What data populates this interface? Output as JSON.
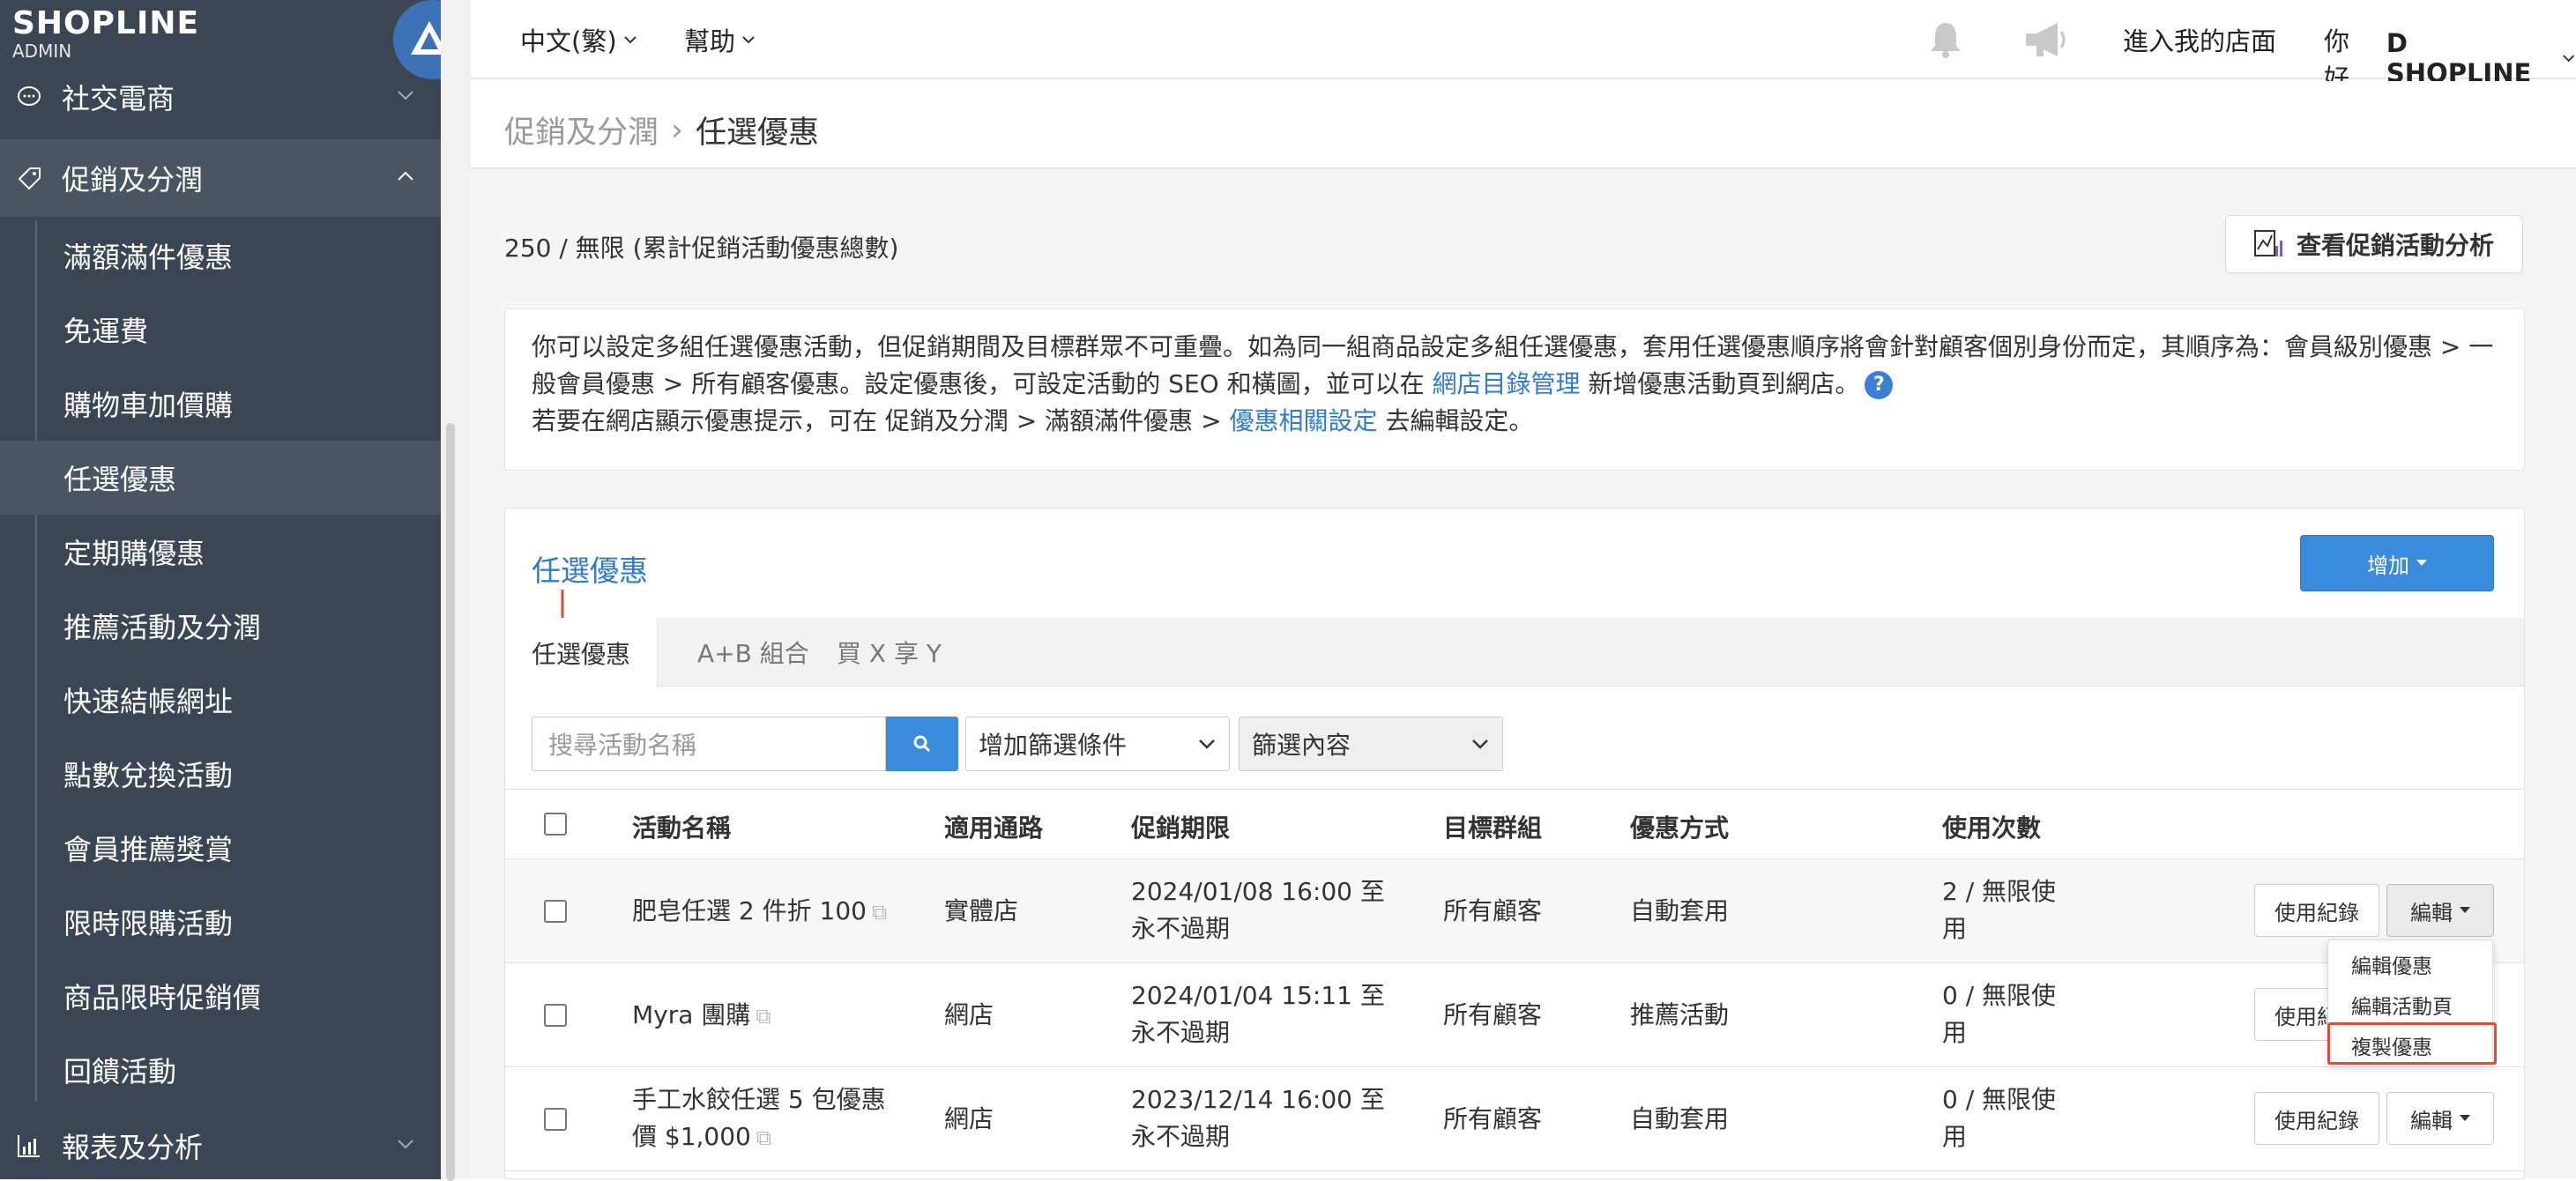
{
  "brand": {
    "name": "SHOPLINE",
    "sub": "ADMIN"
  },
  "sidebar": {
    "groups": [
      {
        "label": "社交電商",
        "icon": "chat-bubble-icon"
      },
      {
        "label": "促銷及分潤",
        "icon": "tag-icon"
      },
      {
        "label": "報表及分析",
        "icon": "chart-icon"
      }
    ],
    "items": [
      {
        "label": "滿額滿件優惠"
      },
      {
        "label": "免運費"
      },
      {
        "label": "購物車加價購"
      },
      {
        "label": "任選優惠"
      },
      {
        "label": "定期購優惠"
      },
      {
        "label": "推薦活動及分潤"
      },
      {
        "label": "快速結帳網址"
      },
      {
        "label": "點數兌換活動"
      },
      {
        "label": "會員推薦獎賞"
      },
      {
        "label": "限時限購活動"
      },
      {
        "label": "商品限時促銷價"
      },
      {
        "label": "回饋活動"
      }
    ]
  },
  "topbar": {
    "language": "中文(繁)",
    "help": "幫助",
    "visit_store": "進入我的店面",
    "greeting_prefix": "你好, ",
    "greeting_name": "D SHOPLINE"
  },
  "breadcrumb": {
    "parent": "促銷及分潤",
    "current": "任選優惠"
  },
  "usage_count": "250 / 無限 (累計促銷活動優惠總數)",
  "analysis_button": "查看促銷活動分析",
  "info": {
    "line1": "你可以設定多組任選優惠活動，但促銷期間及目標群眾不可重疊。如為同一組商品設定多組任選優惠，套用任選優惠順序將會針對顧客個別身份而定，其順序為：會員級別優惠 > 一",
    "line2_a": "般會員優惠 > 所有顧客優惠。設定優惠後，可設定活動的 SEO 和橫圖，並可以在 ",
    "line2_link": "網店目錄管理",
    "line2_b": " 新增優惠活動頁到網店。",
    "line3_a": "若要在網店顯示優惠提示，可在 促銷及分潤 > 滿額滿件優惠 > ",
    "line3_link": "優惠相關設定",
    "line3_b": " 去編輯設定。"
  },
  "panel": {
    "title": "任選優惠",
    "add_button": "增加",
    "tabs": [
      {
        "label": "任選優惠"
      },
      {
        "label": "A+B 組合"
      },
      {
        "label": "買 X 享 Y"
      }
    ],
    "search_placeholder": "搜尋活動名稱",
    "filter_select": "增加篩選條件",
    "filter_content": "篩選內容",
    "columns": [
      "活動名稱",
      "適用通路",
      "促銷期限",
      "目標群組",
      "優惠方式",
      "使用次數"
    ],
    "rows": [
      {
        "name": "肥皂任選 2 件折 100",
        "channel": "實體店",
        "period1": "2024/01/08 16:00 至",
        "period2": "永不過期",
        "target": "所有顧客",
        "method": "自動套用",
        "usage1": "2 / 無限使",
        "usage2": "用"
      },
      {
        "name": "Myra 團購",
        "channel": "網店",
        "period1": "2024/01/04 15:11 至",
        "period2": "永不過期",
        "target": "所有顧客",
        "method": "推薦活動",
        "usage1": "0 / 無限使",
        "usage2": "用"
      },
      {
        "name": "手工水餃任選 5 包優惠",
        "name2": "價 $1,000",
        "channel": "網店",
        "period1": "2023/12/14 16:00 至",
        "period2": "永不過期",
        "target": "所有顧客",
        "method": "自動套用",
        "usage1": "0 / 無限使",
        "usage2": "用"
      }
    ],
    "row_buttons": {
      "history": "使用紀錄",
      "history_partial": "使用紀",
      "edit": "編輯"
    }
  },
  "edit_menu": [
    {
      "label": "編輯優惠"
    },
    {
      "label": "編輯活動頁"
    },
    {
      "label": "複製優惠"
    }
  ],
  "colors": {
    "sidebar": "#3c4553",
    "primary": "#3a8bdc",
    "link": "#2d7bd1",
    "highlight": "#e04b37"
  }
}
